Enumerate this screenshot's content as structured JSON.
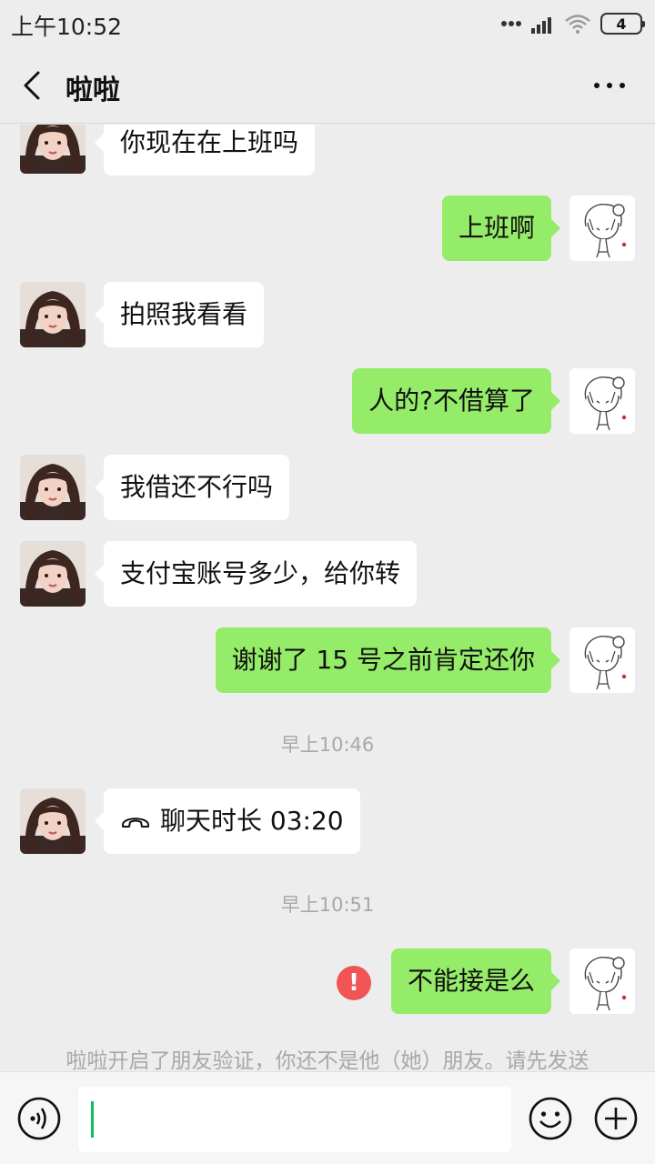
{
  "status_bar": {
    "time": "上午10:52",
    "battery": "4"
  },
  "nav": {
    "title": "啦啦"
  },
  "messages": [
    {
      "text": "你现在在上班吗"
    },
    {
      "text": "上班啊"
    },
    {
      "text": "拍照我看看"
    },
    {
      "text": "人的?不借算了"
    },
    {
      "text": "我借还不行吗"
    },
    {
      "text": "支付宝账号多少，给你转"
    },
    {
      "text": "谢谢了 15 号之前肯定还你"
    },
    {
      "text": "聊天时长 03:20"
    },
    {
      "text": "不能接是么"
    }
  ],
  "timestamps": [
    "早上10:46",
    "早上10:51"
  ],
  "error_mark": "!",
  "system_notice": "啦啦开启了朋友验证，你还不是他（她）朋友。请先发送",
  "icons": {
    "back": "chevron-left-icon",
    "more": "more-dots-icon",
    "voice": "voice-icon",
    "emoji": "emoji-icon",
    "plus": "plus-icon",
    "call": "phone-hangup-icon"
  },
  "colors": {
    "sent_bubble": "#95ec69",
    "received_bubble": "#ffffff",
    "background": "#ededed",
    "error": "#f05454",
    "caret": "#07c160"
  }
}
